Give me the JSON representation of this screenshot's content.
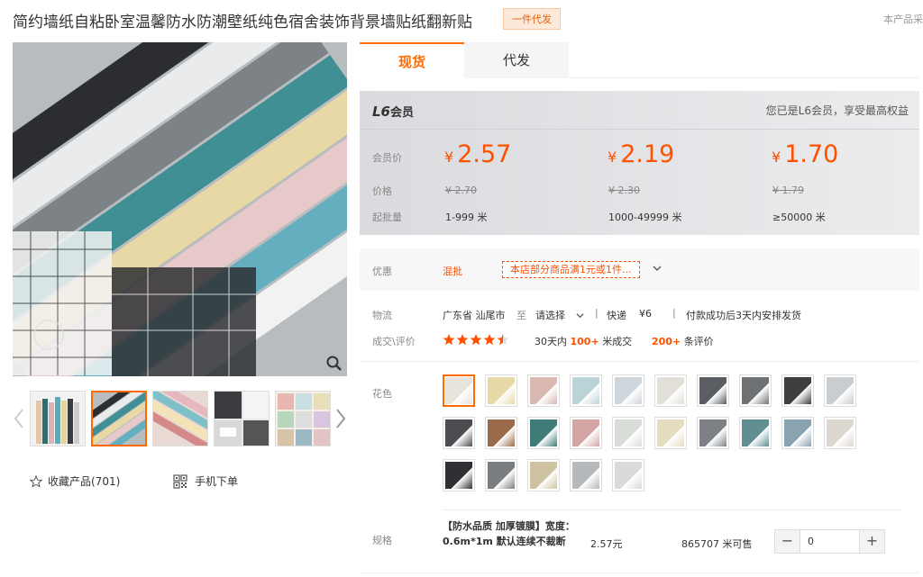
{
  "header": {
    "title": "简约墙纸自粘卧室温馨防水防潮壁纸纯色宿舍装饰背景墙贴纸翻新贴",
    "agent_badge": "一件代发",
    "top_right": "本产品采"
  },
  "gallery": {
    "favorite_label": "收藏产品(701)",
    "mobile_label": "手机下单"
  },
  "tabs": [
    {
      "label": "现货"
    },
    {
      "label": "代发"
    }
  ],
  "member": {
    "level": "L6",
    "level_suffix": "会员",
    "note": "您已是L6会员，享受最高权益",
    "labels": {
      "member_price": "会员价",
      "price": "价格",
      "min_qty": "起批量"
    },
    "tiers": [
      {
        "member_price": "2.57",
        "price": "¥ 2.70",
        "qty": "1-999 米"
      },
      {
        "member_price": "2.19",
        "price": "¥ 2.30",
        "qty": "1000-49999 米"
      },
      {
        "member_price": "1.70",
        "price": "¥ 1.79",
        "qty": "≥50000 米"
      }
    ],
    "currency": "¥"
  },
  "promo": {
    "label": "优惠",
    "type": "混批",
    "tag": "本店部分商品满1元或1件..."
  },
  "logistics": {
    "label": "物流",
    "origin": "广东省 汕尾市",
    "to": "至",
    "destination": "请选择",
    "express": "快递",
    "fee": "¥6",
    "ship_note": "付款成功后3天内安排发货"
  },
  "reviews": {
    "label": "成交\\评价",
    "rating": 4.5,
    "period": "30天内",
    "sold": "100+",
    "sold_unit": "米成交",
    "review_count": "200+",
    "review_unit": "条评价"
  },
  "color": {
    "label": "花色",
    "swatches": [
      "#e8e4dc",
      "#e8d9a8",
      "#d9b8b2",
      "#b9d3d6",
      "#cfd6db",
      "#e2dfd8",
      "#5a5e62",
      "#6f7274",
      "#3c3e40",
      "#c9cdd0",
      "#4b4d50",
      "#9a6b4a",
      "#3f7c78",
      "#d4a5a5",
      "#d9ddd8",
      "#e6dcc0",
      "#7d8186",
      "#5f8f93",
      "#8aa3b0",
      "#dcd8cf",
      "#2e3033",
      "#7a7d80",
      "#cfc2a0",
      "#b6b9bb",
      "#d8dadc"
    ]
  },
  "spec": {
    "label": "规格",
    "name": "【防水品质 加厚镀膜】宽度：0.6m*1m 默认连续不裁断",
    "price": "2.57元",
    "stock": "865707 米可售",
    "quantity": "0",
    "minus": "−",
    "plus": "+"
  }
}
